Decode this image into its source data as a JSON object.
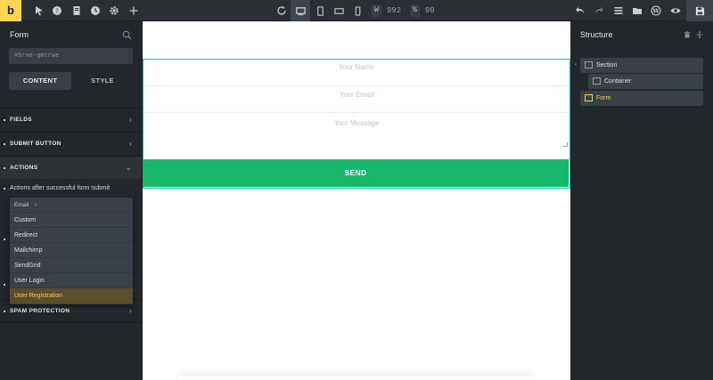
{
  "toolbar": {
    "logo": "b",
    "width_key": "W",
    "width_value": "992",
    "zoom_key": "%",
    "zoom_value": "90",
    "icons": [
      "pointer-icon",
      "help-icon",
      "pages-icon",
      "history-icon",
      "settings-icon",
      "add-icon",
      "undo-icon",
      "redo-icon",
      "layers-icon",
      "folder-icon",
      "wordpress-icon",
      "preview-icon",
      "save-icon"
    ]
  },
  "left": {
    "title": "Form",
    "element_id": "#brxe-gmtrwe",
    "tabs": [
      "CONTENT",
      "STYLE"
    ],
    "sections": {
      "fields": "FIELDS",
      "submit": "SUBMIT BUTTON",
      "actions": "ACTIONS",
      "spam": "SPAM PROTECTION"
    },
    "actions_label": "Actions after successful form submit",
    "dropdown": {
      "selected": "Email",
      "remove": "×",
      "options": [
        "Custom",
        "Redirect",
        "Mailchimp",
        "SendGrid",
        "User Login",
        "User Registration"
      ]
    }
  },
  "canvas": {
    "name_placeholder": "Your Name",
    "email_placeholder": "Your Email",
    "message_placeholder": "Your Message",
    "send_label": "SEND"
  },
  "right": {
    "title": "Structure",
    "tree": [
      "Section",
      "Container",
      "Form"
    ]
  },
  "colors": {
    "accent_yellow": "#ffd64f",
    "send_green": "#17b86c",
    "selection_outline": "#17c3b2",
    "highlight_text": "#ffcf57"
  }
}
